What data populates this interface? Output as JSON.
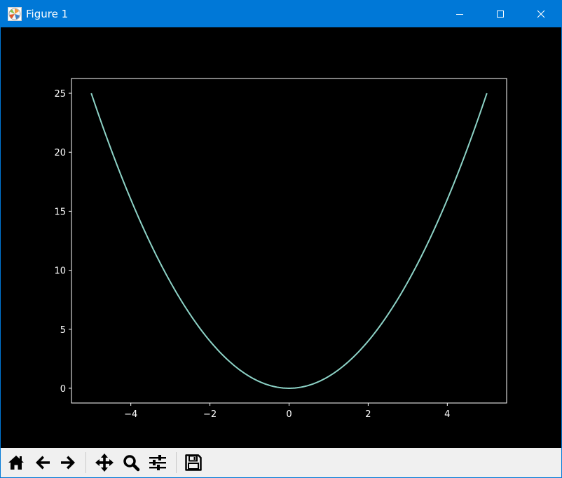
{
  "window": {
    "title": "Figure 1",
    "controls": [
      "minimize",
      "maximize",
      "close"
    ],
    "titlebar_color": "#0078d7"
  },
  "toolbar": {
    "buttons": [
      {
        "name": "home",
        "icon": "home-icon"
      },
      {
        "name": "back",
        "icon": "arrow-left-icon"
      },
      {
        "name": "forward",
        "icon": "arrow-right-icon"
      },
      {
        "name": "pan",
        "icon": "move-icon"
      },
      {
        "name": "zoom",
        "icon": "magnifier-icon"
      },
      {
        "name": "configure-subplots",
        "icon": "sliders-icon"
      },
      {
        "name": "save",
        "icon": "floppy-disk-icon"
      }
    ]
  },
  "chart_data": {
    "type": "line",
    "function": "y = x^2",
    "x": [
      -5,
      -4.5,
      -4,
      -3.5,
      -3,
      -2.5,
      -2,
      -1.5,
      -1,
      -0.5,
      0,
      0.5,
      1,
      1.5,
      2,
      2.5,
      3,
      3.5,
      4,
      4.5,
      5
    ],
    "series": [
      {
        "values": [
          25,
          20.25,
          16,
          12.25,
          9,
          6.25,
          4,
          2.25,
          1,
          0.25,
          0,
          0.25,
          1,
          2.25,
          4,
          6.25,
          9,
          12.25,
          16,
          20.25,
          25
        ],
        "color": "#8dd3c7"
      }
    ],
    "xlim": [
      -5.5,
      5.5
    ],
    "ylim": [
      -1.25,
      26.25
    ],
    "xticks": [
      -4,
      -2,
      0,
      2,
      4
    ],
    "xtick_labels": [
      "−4",
      "−2",
      "0",
      "2",
      "4"
    ],
    "yticks": [
      0,
      5,
      10,
      15,
      20,
      25
    ],
    "ytick_labels": [
      "0",
      "5",
      "10",
      "15",
      "20",
      "25"
    ],
    "title": "",
    "xlabel": "",
    "ylabel": "",
    "grid": false,
    "style": "dark_background",
    "background": "#000000",
    "axis_color": "#ffffff"
  }
}
